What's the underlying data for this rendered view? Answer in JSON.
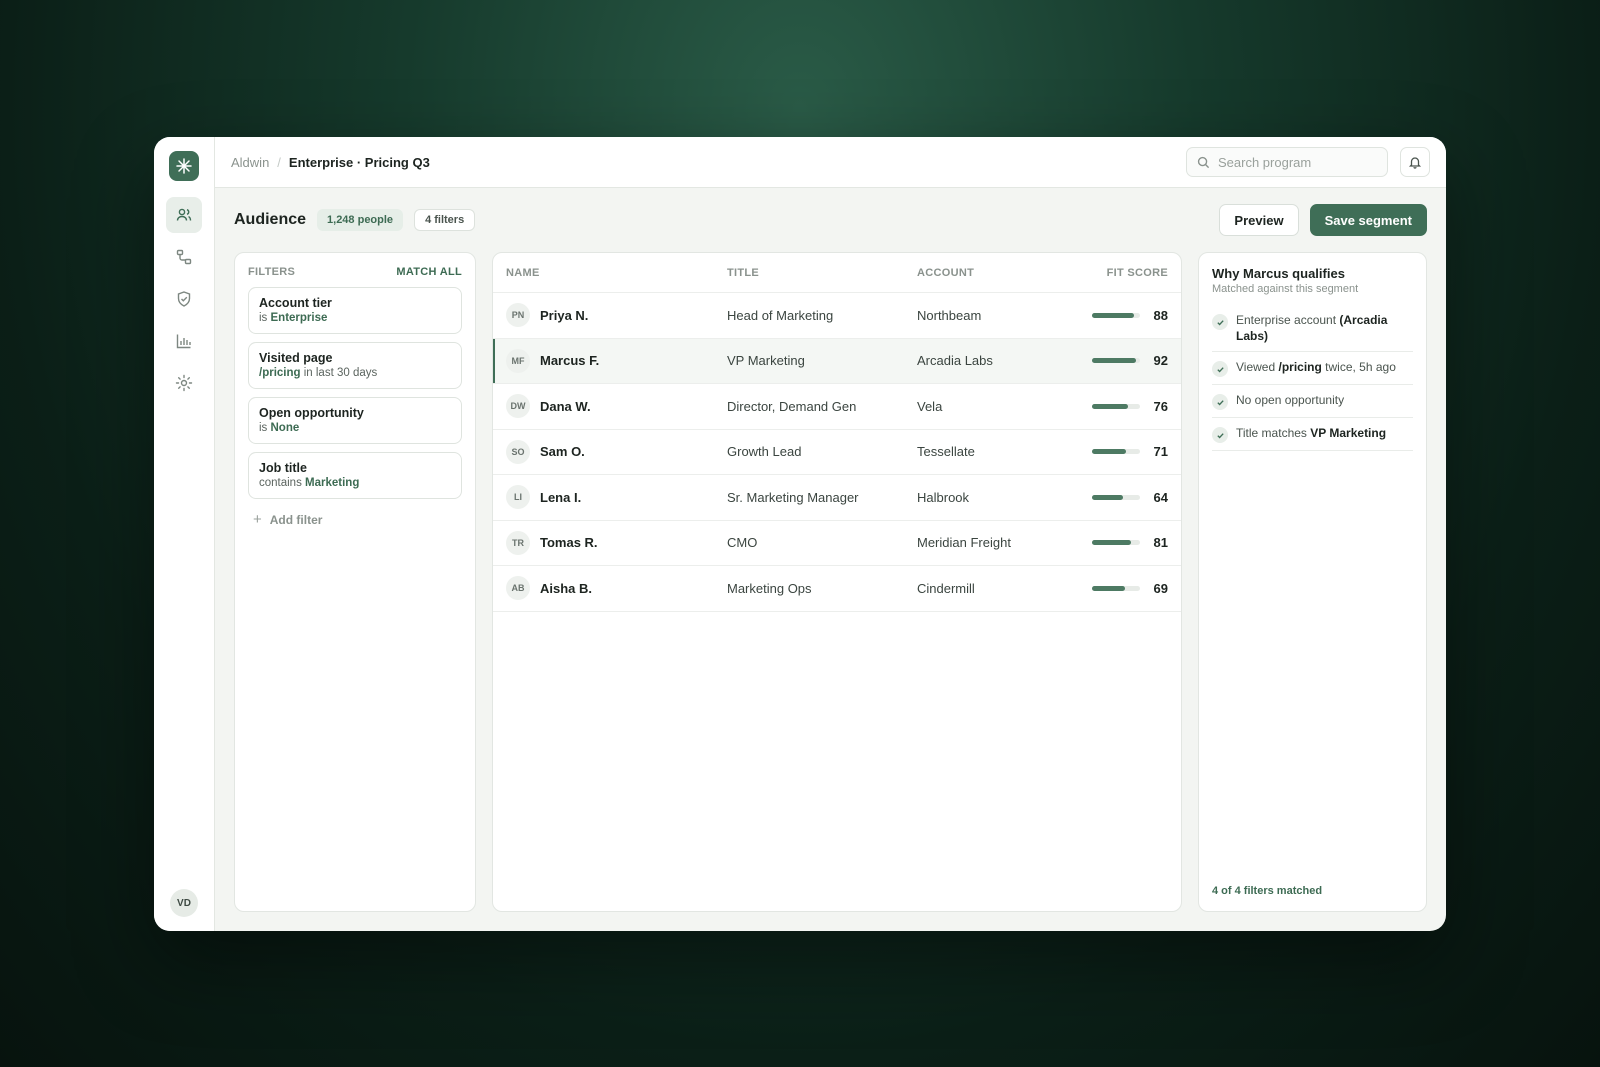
{
  "breadcrumb": {
    "root": "Aldwin",
    "separator": "/",
    "current": "Enterprise · Pricing Q3"
  },
  "search": {
    "placeholder": "Search program"
  },
  "rail": {
    "avatar_initials": "VD",
    "items": [
      "users-icon",
      "flow-icon",
      "shield-icon",
      "chart-icon",
      "settings-icon"
    ]
  },
  "header": {
    "title": "Audience",
    "people_count": "1,248 people",
    "filter_count": "4 filters",
    "preview_label": "Preview",
    "save_label": "Save segment"
  },
  "filters": {
    "heading": "FILTERS",
    "match_label": "MATCH ALL",
    "items": [
      {
        "title": "Account tier",
        "pre": "is ",
        "value": "Enterprise",
        "post": ""
      },
      {
        "title": "Visited page",
        "pre": "",
        "value": "/pricing",
        "post": " in last 30 days"
      },
      {
        "title": "Open opportunity",
        "pre": "is ",
        "value": "None",
        "post": ""
      },
      {
        "title": "Job title",
        "pre": "contains ",
        "value": "Marketing",
        "post": ""
      }
    ],
    "add_label": "Add filter"
  },
  "table": {
    "columns": {
      "name": "NAME",
      "title": "TITLE",
      "account": "ACCOUNT",
      "fit": "FIT SCORE"
    },
    "rows": [
      {
        "initials": "PN",
        "name": "Priya N.",
        "title": "Head of Marketing",
        "account": "Northbeam",
        "score": 88
      },
      {
        "initials": "MF",
        "name": "Marcus F.",
        "title": "VP Marketing",
        "account": "Arcadia Labs",
        "score": 92,
        "selected": true
      },
      {
        "initials": "DW",
        "name": "Dana W.",
        "title": "Director, Demand Gen",
        "account": "Vela",
        "score": 76
      },
      {
        "initials": "SO",
        "name": "Sam O.",
        "title": "Growth Lead",
        "account": "Tessellate",
        "score": 71
      },
      {
        "initials": "LI",
        "name": "Lena I.",
        "title": "Sr. Marketing Manager",
        "account": "Halbrook",
        "score": 64
      },
      {
        "initials": "TR",
        "name": "Tomas R.",
        "title": "CMO",
        "account": "Meridian Freight",
        "score": 81
      },
      {
        "initials": "AB",
        "name": "Aisha B.",
        "title": "Marketing Ops",
        "account": "Cindermill",
        "score": 69
      }
    ]
  },
  "why": {
    "title": "Why Marcus qualifies",
    "subtitle": "Matched against this segment",
    "reasons": [
      {
        "pre": "Enterprise account ",
        "bold": "(Arcadia Labs)",
        "post": ""
      },
      {
        "pre": "Viewed ",
        "bold": "/pricing",
        "post": " twice, 5h ago"
      },
      {
        "pre": "No open opportunity",
        "bold": "",
        "post": ""
      },
      {
        "pre": "Title matches ",
        "bold": "VP Marketing",
        "post": ""
      }
    ],
    "footer": "4 of 4 filters matched"
  },
  "colors": {
    "accent": "#3f6e57",
    "bar": "#4d7a63",
    "track": "#e7ebe7"
  }
}
